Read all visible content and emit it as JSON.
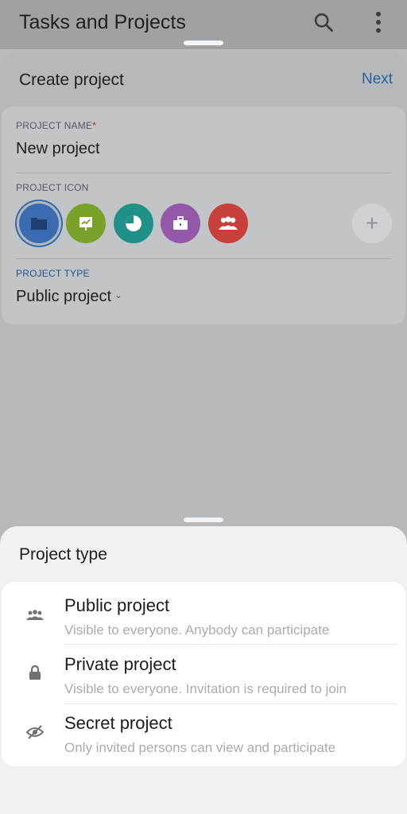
{
  "appbar": {
    "title": "Tasks and Projects",
    "search_icon": "search-icon",
    "more_icon": "more-vert-icon"
  },
  "create": {
    "title": "Create project",
    "next_label": "Next",
    "name_label": "PROJECT NAME",
    "required_mark": "*",
    "name_value": "New project",
    "icon_label": "PROJECT ICON",
    "icons": [
      {
        "name": "folder-icon",
        "color": "#3a6ab0",
        "selected": true
      },
      {
        "name": "presentation-icon",
        "color": "#7aa12a"
      },
      {
        "name": "pie-chart-icon",
        "color": "#1f9187"
      },
      {
        "name": "briefcase-icon",
        "color": "#9358a8"
      },
      {
        "name": "group-icon",
        "color": "#c8403b"
      }
    ],
    "add_icon_label": "+",
    "type_label": "PROJECT TYPE",
    "type_value": "Public project",
    "type_chevron": "⌄"
  },
  "project_type_sheet": {
    "title": "Project type",
    "options": [
      {
        "icon": "people-icon",
        "title": "Public project",
        "subtitle": "Visible to everyone. Anybody can participate"
      },
      {
        "icon": "lock-icon",
        "title": "Private project",
        "subtitle": "Visible to everyone. Invitation is required to join"
      },
      {
        "icon": "eye-off-icon",
        "title": "Secret project",
        "subtitle": "Only invited persons can view and participate"
      }
    ]
  },
  "colors": {
    "accent_blue": "#2c5e9c",
    "required_red": "#c02020"
  }
}
